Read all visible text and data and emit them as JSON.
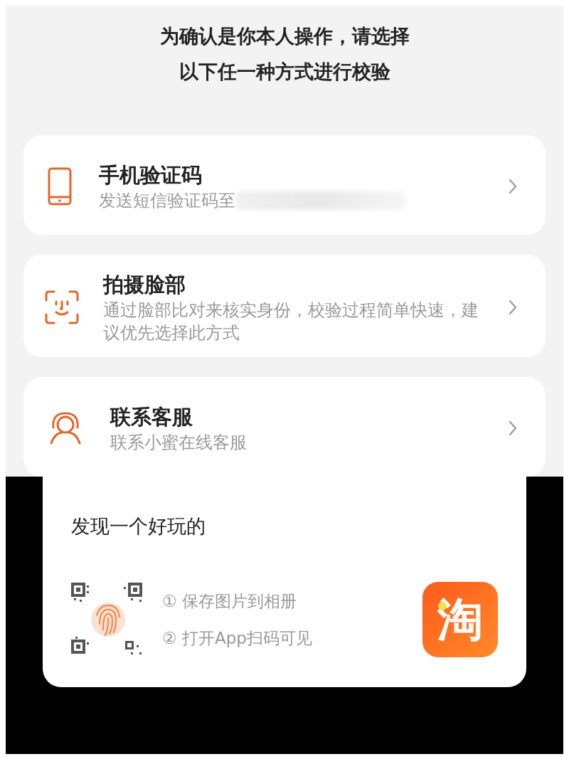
{
  "heading": [
    "为确认是你本人操作，请选择",
    "以下任一种方式进行校验"
  ],
  "options": [
    {
      "kind": "phone",
      "title": "手机验证码",
      "subtitle": "发送短信验证码至",
      "redacted": true
    },
    {
      "kind": "face",
      "title": "拍摄脸部",
      "subtitle": "通过脸部比对来核实身份，校验过程简单快速，建议优先选择此方式",
      "redacted": false
    },
    {
      "kind": "service",
      "title": "联系客服",
      "subtitle": "联系小蜜在线客服",
      "redacted": false
    }
  ],
  "share_card": {
    "title": "发现一个好玩的",
    "steps": [
      "① 保存图片到相册",
      "② 打开App扫码可见"
    ],
    "logo_text": "淘"
  }
}
